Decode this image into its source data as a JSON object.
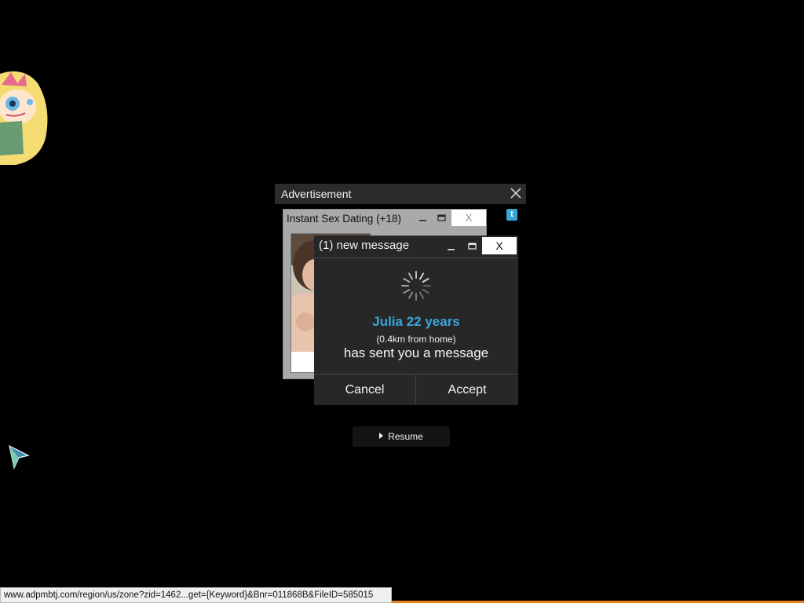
{
  "ad_frame": {
    "title": "Advertisement"
  },
  "dating_window": {
    "title": "Instant Sex Dating (+18)",
    "close_label": "X"
  },
  "message_window": {
    "title": "(1) new message",
    "close_label": "X",
    "sender": "Julia 22 years",
    "distance": "(0.4km from home)",
    "text": "has sent you a message",
    "cancel_label": "Cancel",
    "accept_label": "Accept"
  },
  "resume_button": {
    "label": "Resume"
  },
  "status_bar": {
    "url": "www.adpmbtj.com/region/us/zone?zid=1462...get={Keyword}&Bnr=011868B&FileID=585015"
  },
  "colors": {
    "background": "#000000",
    "accent_name": "#39a7dd",
    "popup_dark": "#272727",
    "popup_grey": "#a9a9a9",
    "bottom_strip": "#e8821e"
  },
  "icons": {
    "ad_close": "close-x-icon",
    "spinner": "loading-spinner-icon",
    "tumblr": "tumblr-icon",
    "cursor": "arrow-cursor-icon",
    "play": "play-triangle-icon"
  }
}
